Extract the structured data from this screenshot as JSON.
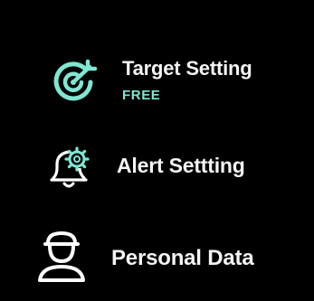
{
  "menu": {
    "items": [
      {
        "label": "Target Setting",
        "sublabel": "FREE",
        "icon": "target-icon"
      },
      {
        "label": "Alert Settting",
        "icon": "bell-gear-icon"
      },
      {
        "label": "Personal Data",
        "icon": "person-icon"
      }
    ]
  },
  "colors": {
    "background": "#000000",
    "text": "#f4f4f4",
    "accent": "#7fe6d2",
    "icon_primary": "#ffffff"
  }
}
